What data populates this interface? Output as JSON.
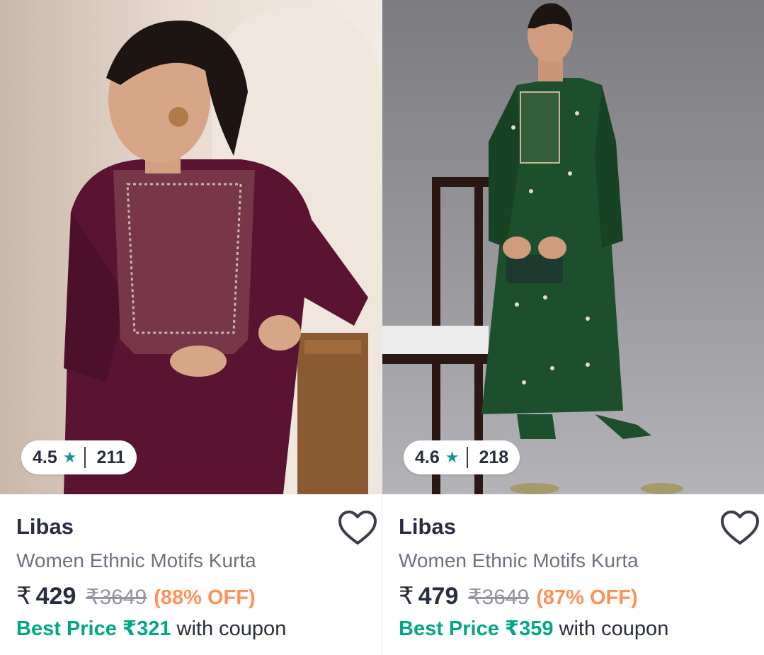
{
  "products": [
    {
      "rating": "4.5",
      "rating_count": "211",
      "brand": "Libas",
      "title": "Women Ethnic Motifs Kurta",
      "currency": "₹",
      "price": "429",
      "mrp": "₹3649",
      "discount": "(88% OFF)",
      "best_price_label": "Best Price ₹321",
      "best_price_suffix": "with coupon",
      "kurta_color": "#5a1431"
    },
    {
      "rating": "4.6",
      "rating_count": "218",
      "brand": "Libas",
      "title": "Women Ethnic Motifs Kurta",
      "currency": "₹",
      "price": "479",
      "mrp": "₹3649",
      "discount": "(87% OFF)",
      "best_price_label": "Best Price ₹359",
      "best_price_suffix": "with coupon",
      "kurta_color": "#1d4f2c"
    }
  ],
  "colors": {
    "rating_star": "#14958f",
    "discount": "#ff905a",
    "best_price": "#03a685"
  },
  "icons": {
    "star": "star-icon",
    "wishlist": "heart-outline-icon"
  }
}
